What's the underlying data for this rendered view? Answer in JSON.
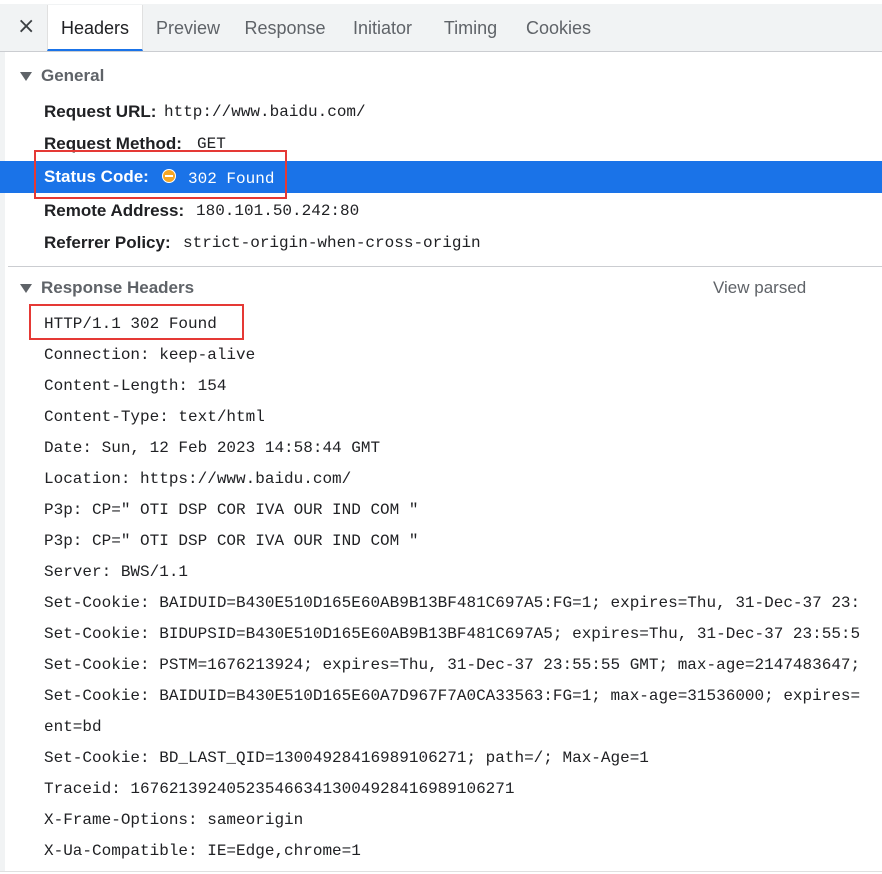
{
  "tabs": [
    {
      "label": "Headers",
      "active": true
    },
    {
      "label": "Preview"
    },
    {
      "label": "Response"
    },
    {
      "label": "Initiator"
    },
    {
      "label": "Timing"
    },
    {
      "label": "Cookies"
    }
  ],
  "close_glyph": "×",
  "general": {
    "title": "General",
    "rows": [
      {
        "key": "Request URL:",
        "value": "http://www.baidu.com/"
      },
      {
        "key": "Request Method:",
        "value": "GET"
      },
      {
        "key": "Status Code:",
        "value": "302 Found"
      },
      {
        "key": "Remote Address:",
        "value": "180.101.50.242:80"
      },
      {
        "key": "Referrer Policy:",
        "value": "strict-origin-when-cross-origin"
      }
    ]
  },
  "response_headers": {
    "title": "Response Headers",
    "view_parsed": "View parsed",
    "lines": [
      "HTTP/1.1 302 Found",
      "Connection: keep-alive",
      "Content-Length: 154",
      "Content-Type: text/html",
      "Date: Sun, 12 Feb 2023 14:58:44 GMT",
      "Location: https://www.baidu.com/",
      "P3p: CP=\" OTI DSP COR IVA OUR IND COM \"",
      "P3p: CP=\" OTI DSP COR IVA OUR IND COM \"",
      "Server: BWS/1.1",
      "Set-Cookie: BAIDUID=B430E510D165E60AB9B13BF481C697A5:FG=1; expires=Thu, 31-Dec-37 23:",
      "Set-Cookie: BIDUPSID=B430E510D165E60AB9B13BF481C697A5; expires=Thu, 31-Dec-37 23:55:5",
      "Set-Cookie: PSTM=1676213924; expires=Thu, 31-Dec-37 23:55:55 GMT; max-age=2147483647;",
      "Set-Cookie: BAIDUID=B430E510D165E60A7D967F7A0CA33563:FG=1; max-age=31536000; expires=",
      "ent=bd",
      "Set-Cookie: BD_LAST_QID=13004928416989106271; path=/; Max-Age=1",
      "Traceid: 1676213924052354663413004928416989106271",
      "X-Frame-Options: sameorigin",
      "X-Ua-Compatible: IE=Edge,chrome=1"
    ]
  },
  "colors": {
    "selected_row": "#1a73e8",
    "annotation": "#e53935",
    "status_dot": "#f5a623"
  }
}
